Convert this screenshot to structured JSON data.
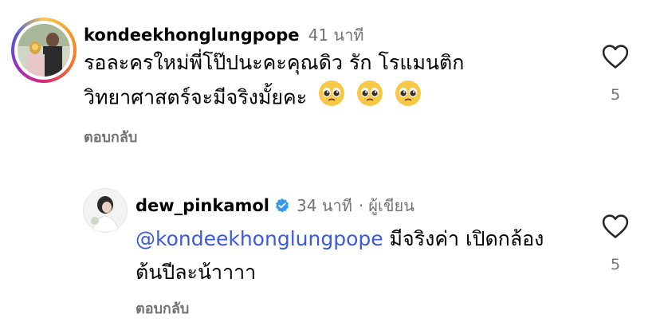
{
  "comments": [
    {
      "username": "kondeekhonglungpope",
      "time": "41 นาที",
      "text": "รอละครใหม่พี่โป๊ปนะคะคุณดิว รัก โรแมนติก",
      "text_line2": "วิทยาศาสตร์จะมีจริงมั้ยคะ",
      "emoji_icon": "pleading-face-icon",
      "likes": "5",
      "reply_label": "ตอบกลับ"
    },
    {
      "username": "dew_pinkamol",
      "verified_icon": "verified-badge-icon",
      "time": "34 นาที",
      "separator": "·",
      "author_tag": "ผู้เขียน",
      "mention": "@kondeekhonglungpope",
      "text": " มีจริงค่า เปิดกล้อง",
      "text_line2": "ต้นปีละน้าาาา",
      "likes": "5",
      "reply_label": "ตอบกลับ"
    }
  ],
  "colors": {
    "mention": "#3b5bdb",
    "verified": "#3897f0",
    "muted": "#737373"
  }
}
